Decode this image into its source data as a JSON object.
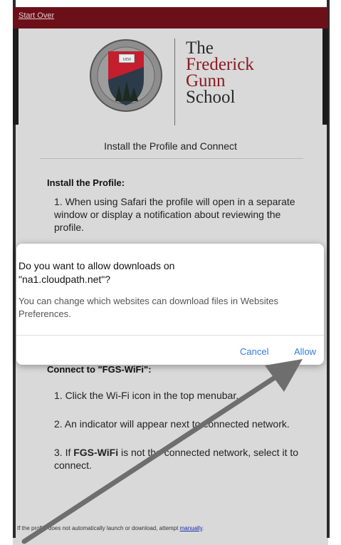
{
  "header": {
    "start_over_label": "Start Over",
    "school_name_line1": "The",
    "school_name_line2": "Frederick",
    "school_name_line3": "Gunn",
    "school_name_line4": "School",
    "crest_year": "1850"
  },
  "main": {
    "section_title": "Install the Profile and Connect",
    "install_heading": "Install the Profile:",
    "install_step1": "1. When using Safari the profile will open in a separate window or display a notification about reviewing the profile.",
    "connect_heading": "Connect to \"FGS-WiFi\":",
    "connect_step1": "1. Click the Wi-Fi icon in the top menubar.",
    "connect_step2": "2. An indicator will appear next to connected network.",
    "connect_step3_prefix": "3. If ",
    "connect_step3_bold": "FGS-WiFi",
    "connect_step3_suffix": " is not the connected network, select it to connect.",
    "footer_text": "If the profile does not automatically launch or download, attempt ",
    "footer_link": "manually",
    "footer_suffix": "."
  },
  "dialog": {
    "title": "Do you want to allow downloads on \"na1.cloudpath.net\"?",
    "body": "You can change which websites can download files in Websites Preferences.",
    "cancel_label": "Cancel",
    "allow_label": "Allow"
  },
  "colors": {
    "topbar": "#6b1019",
    "school_red": "#8a1a22",
    "dialog_button": "#2f7de1"
  }
}
